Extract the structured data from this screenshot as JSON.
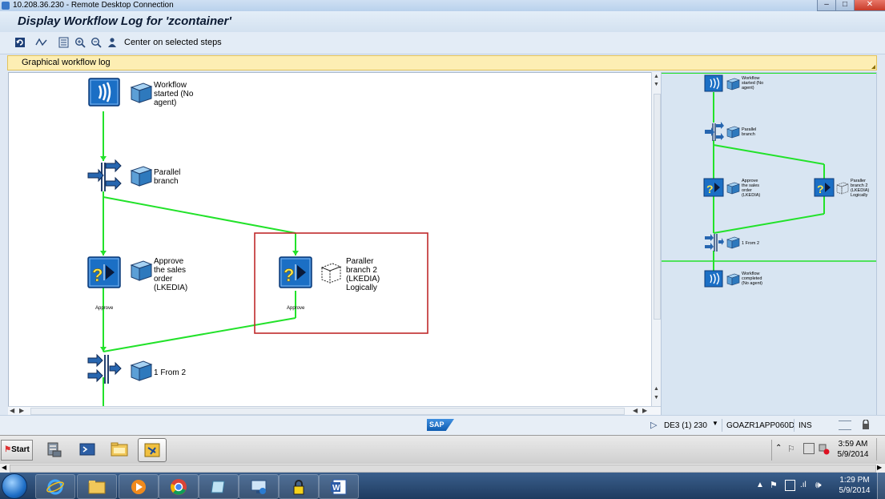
{
  "rdp": {
    "title": "10.208.36.230 - Remote Desktop Connection",
    "min_label": "–",
    "max_label": "□",
    "close_label": "✕"
  },
  "sap": {
    "title": "Display Workflow Log for 'zcontainer'",
    "toolbar": {
      "center_label": "Center on selected steps"
    },
    "section_label": "Graphical workflow log"
  },
  "workflow": {
    "nodes": [
      {
        "id": "start",
        "lines": [
          "Workflow",
          "started (No",
          "agent)"
        ]
      },
      {
        "id": "parallel",
        "lines": [
          "Parallel",
          "branch"
        ]
      },
      {
        "id": "approve",
        "lines": [
          "Approve",
          "the sales",
          "order",
          "(LKEDIA)"
        ],
        "caption": "Approve"
      },
      {
        "id": "paraller2",
        "lines": [
          "Paraller",
          "branch 2",
          "(LKEDIA)",
          "Logically"
        ],
        "caption": "Approve"
      },
      {
        "id": "join",
        "lines": [
          "1 From 2"
        ]
      }
    ],
    "overview_nodes": [
      {
        "id": "start",
        "lines": [
          "Workflow",
          "started (No",
          "agent)"
        ]
      },
      {
        "id": "parallel",
        "lines": [
          "Parallel",
          "branch"
        ]
      },
      {
        "id": "approve",
        "lines": [
          "Approve",
          "the sales",
          "order",
          "(LKEDIA)"
        ]
      },
      {
        "id": "paraller2",
        "lines": [
          "Paraller",
          "branch 2",
          "(LKEDIA)",
          "Logically"
        ]
      },
      {
        "id": "join",
        "lines": [
          "1 From 2"
        ]
      },
      {
        "id": "complete",
        "lines": [
          "Workflow",
          "completed",
          "(No agent)"
        ]
      }
    ],
    "colors": {
      "edge": "#22e22a",
      "highlight": "#c0292b",
      "icon_bg": "#1a73c8"
    }
  },
  "status": {
    "sap_logo": "SAP",
    "system": "DE3 (1) 230",
    "server": "GOAZR1APP060D",
    "mode": "INS"
  },
  "rdp_taskbar": {
    "start_label": "Start",
    "time": "3:59 AM",
    "date": "5/9/2014"
  },
  "host_taskbar": {
    "time": "1:29 PM",
    "date": "5/9/2014"
  }
}
